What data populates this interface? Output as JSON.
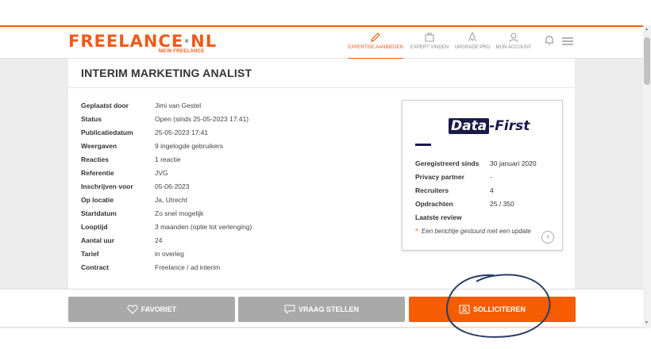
{
  "header": {
    "logo": "FREELANCE",
    "logo_dot": "·",
    "logo_tld": "NL",
    "logo_sub": "MEIN FREELANCE",
    "nav": [
      {
        "label": "EXPERTISE AANBIEDEN",
        "icon": "pencil-icon",
        "active": true
      },
      {
        "label": "EXPERT VINDEN",
        "icon": "briefcase-icon",
        "active": false
      },
      {
        "label": "UPGRADE PRO",
        "icon": "rocket-icon",
        "active": false
      },
      {
        "label": "MIJN ACCOUNT",
        "icon": "user-icon",
        "active": false
      }
    ]
  },
  "job": {
    "title": "INTERIM MARKETING ANALIST",
    "details": [
      {
        "key": "Geplaatst door",
        "value": "Jimi van Gestel"
      },
      {
        "key": "Status",
        "value": "Open (sinds 25-05-2023 17:41)"
      },
      {
        "key": "Publicatiedatum",
        "value": "25-05-2023 17:41"
      },
      {
        "key": "Weergaven",
        "value": "9 ingelogde gebruikers"
      },
      {
        "key": "Reacties",
        "value": "1 reactie"
      },
      {
        "key": "Referentie",
        "value": "JVG"
      },
      {
        "key": "Inschrijven voor",
        "value": "05-06-2023"
      },
      {
        "key": "Op locatie",
        "value": "Ja, Utrecht"
      },
      {
        "key": "Startdatum",
        "value": "Zo snel mogelijk"
      },
      {
        "key": "Looptijd",
        "value": "3 maanden (optie tot verlenging)"
      },
      {
        "key": "Aantal uur",
        "value": "24"
      },
      {
        "key": "Tarief",
        "value": "in overleg"
      },
      {
        "key": "Contract",
        "value": "Freelance / ad interim"
      }
    ]
  },
  "company": {
    "logo_part1": "Data",
    "logo_part2": "First",
    "rows": [
      {
        "key": "Geregistreerd sinds",
        "value": "30 januari 2020"
      },
      {
        "key": "Privacy partner",
        "value": "-"
      },
      {
        "key": "Recruiters",
        "value": "4"
      },
      {
        "key": "Opdrachten",
        "value": "25 / 350"
      },
      {
        "key": "Laatste review",
        "value": ""
      }
    ],
    "review": "Een berichtje gestuurd met een update"
  },
  "actions": {
    "favoriet": "FAVORIET",
    "vraag": "VRAAG STELLEN",
    "solliciteren": "SOLLICITEREN"
  },
  "colors": {
    "accent": "#f05a1a",
    "button_grey": "#a9a9a9",
    "button_orange": "#f55d00",
    "annotation": "#2a3d66"
  }
}
